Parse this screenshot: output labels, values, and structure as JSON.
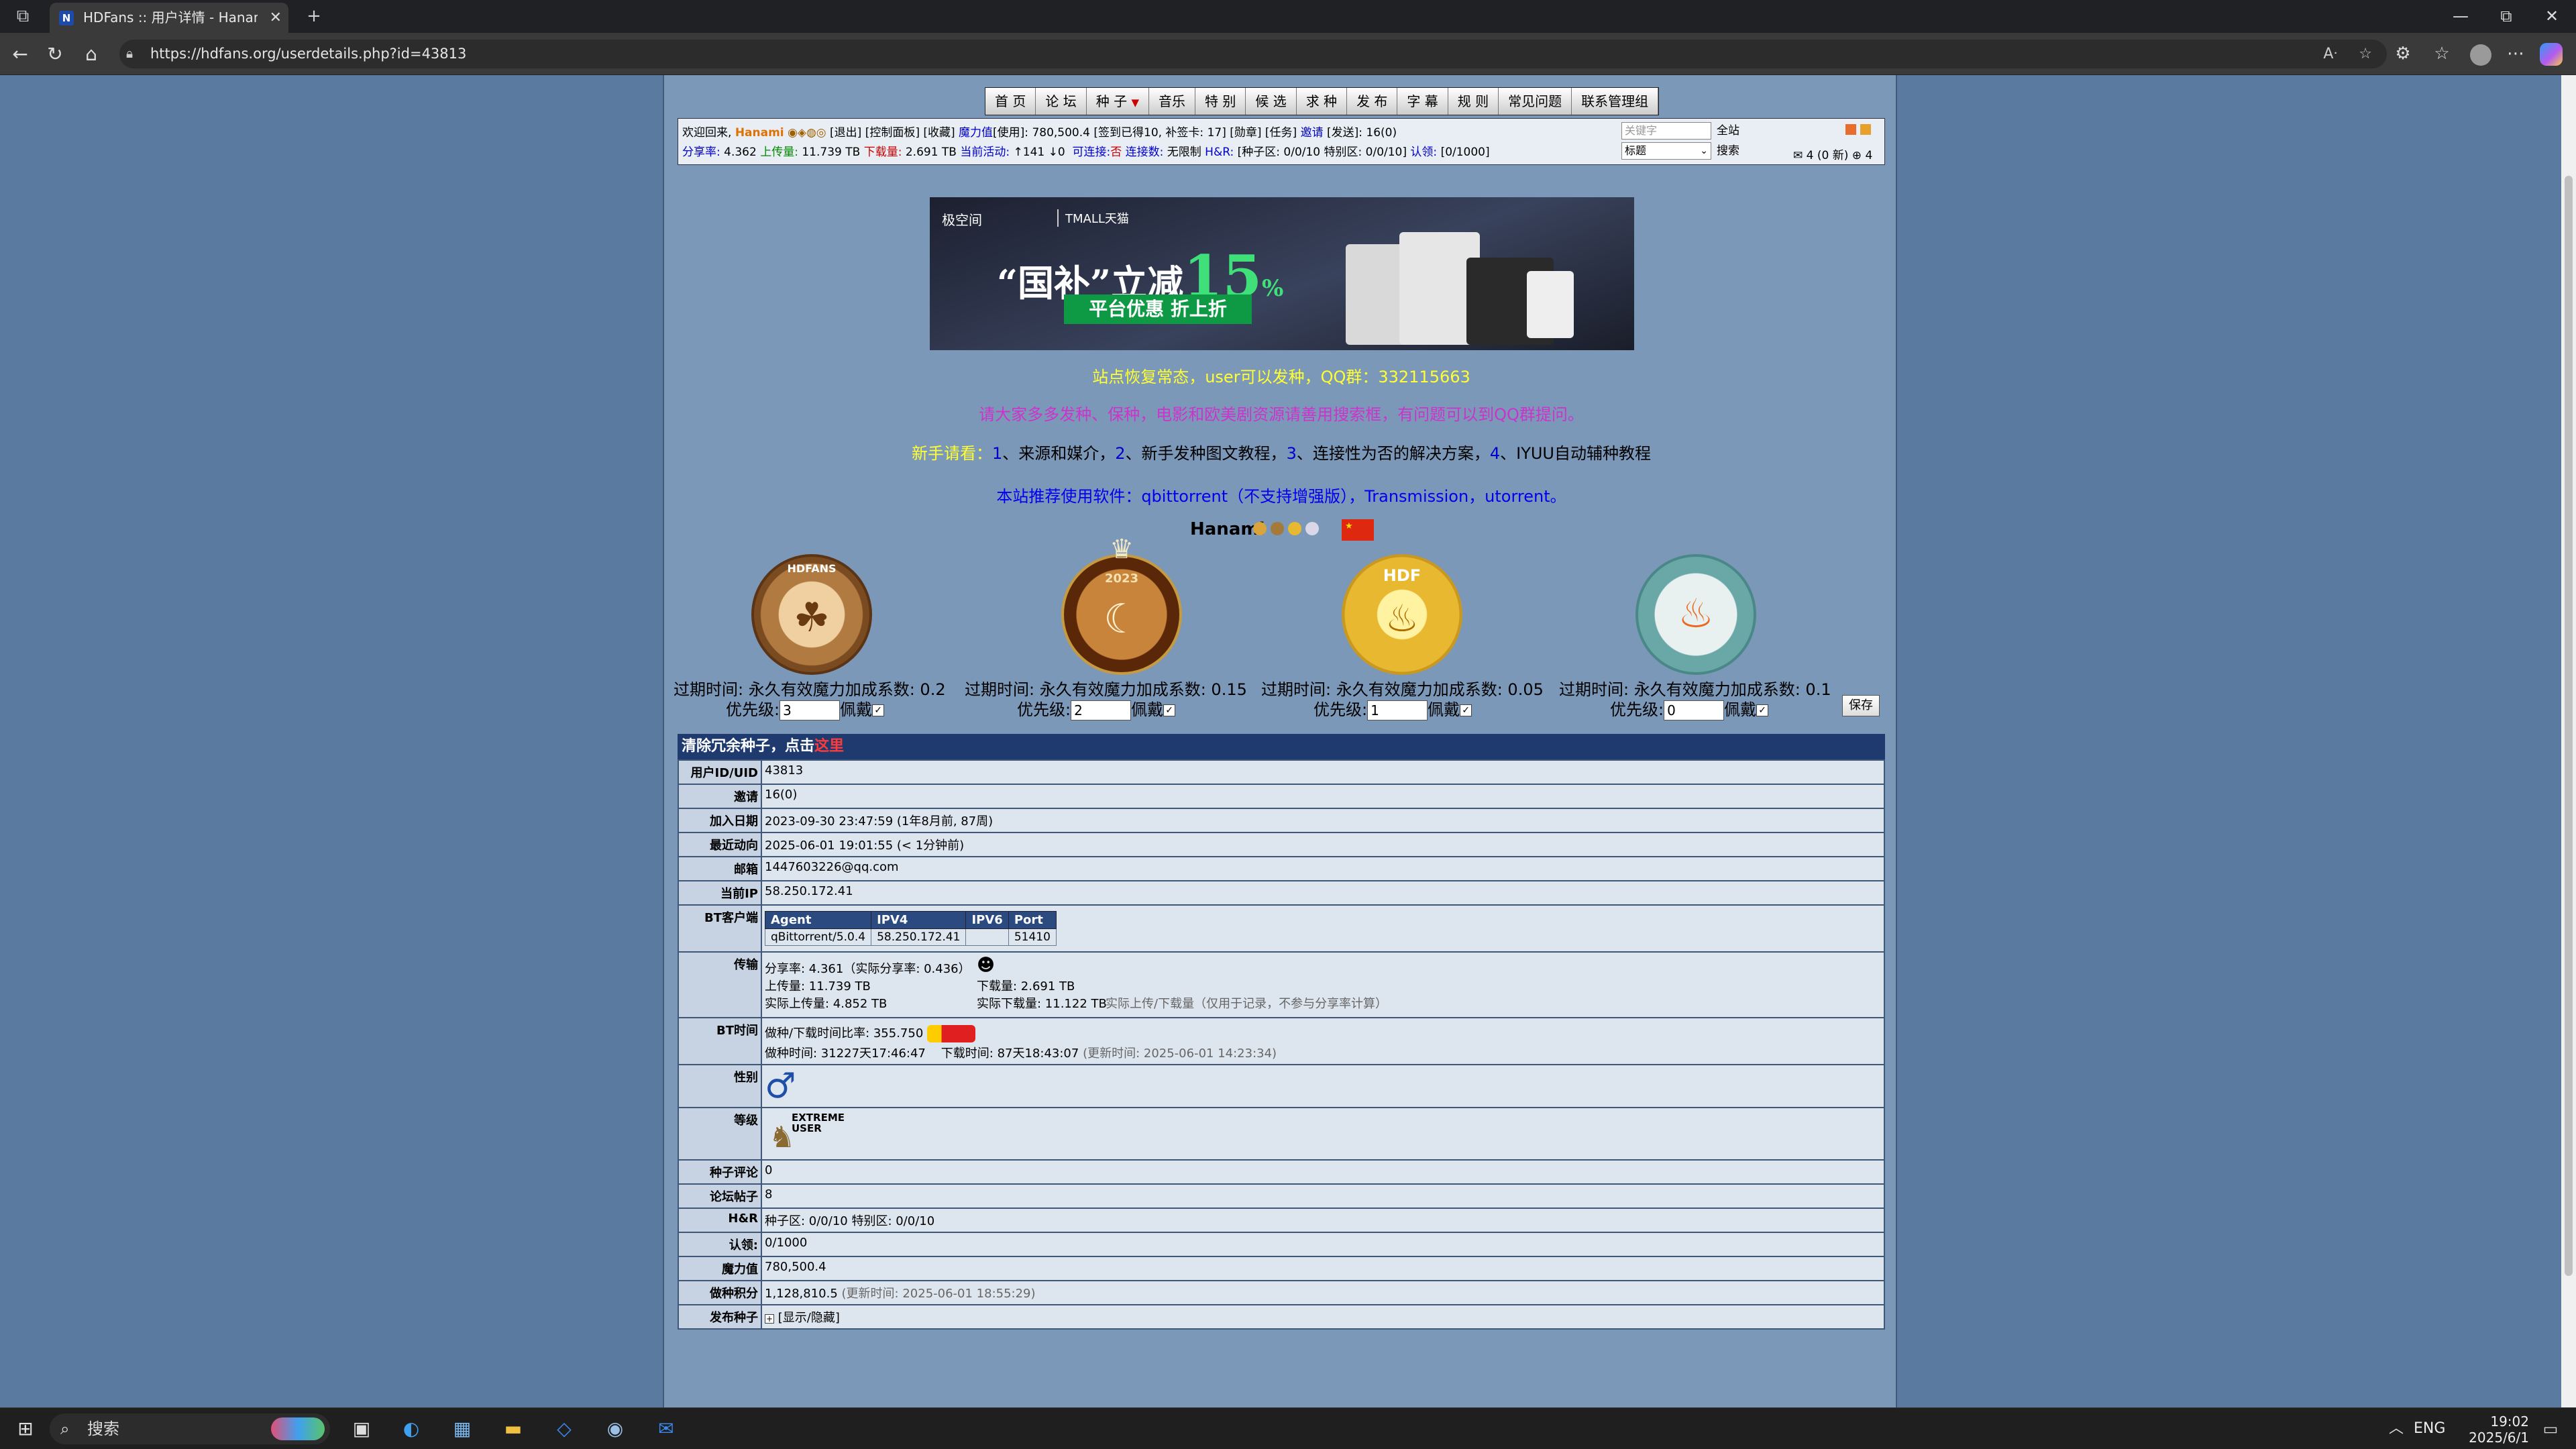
{
  "browser": {
    "tab_title": "HDFans :: 用户详情 - Hanami - Po",
    "tab_favicon": "N",
    "url": "https://hdfans.org/userdetails.php?id=43813",
    "icons": [
      "tab-actions-icon",
      "close-tab-icon",
      "new-tab-icon",
      "minimize-icon",
      "restore-icon",
      "close-window-icon",
      "back-icon",
      "refresh-icon",
      "home-icon",
      "lock-icon",
      "read-aloud-icon",
      "favorite-icon",
      "extensions-icon",
      "collections-icon",
      "profile-icon",
      "more-icon",
      "copilot-icon"
    ]
  },
  "nav": {
    "items": [
      "首 页",
      "论 坛",
      "种 子",
      "音乐",
      "特 别",
      "候 选",
      "求 种",
      "发 布",
      "字 幕",
      "规 则",
      "常见问题",
      "联系管理组"
    ]
  },
  "infobar": {
    "line1_prefix": "欢迎回来,",
    "username": "Hanami",
    "line1_links": "[退出] [控制面板] [收藏]",
    "magic_label": "魔力值",
    "line1_rest": "[使用]: 780,500.4 [签到已得10, 补签卡: 17] [勋章] [任务]",
    "invite_label": "邀请",
    "line1_tail": "[发送]: 16(0)",
    "ratio_label": "分享率:",
    "ratio": "4.362",
    "upload_label": "上传量:",
    "upload": "11.739 TB",
    "download_label": "下载量:",
    "download": "2.691 TB",
    "active_label": "当前活动:",
    "active": "↑141 ↓0",
    "connectable_label": "可连接:",
    "connectable": "否",
    "conn_count_label": "连接数:",
    "conn_count": "无限制",
    "hr_label": "H&R:",
    "hr_value": "[种子区: 0/0/10 特别区: 0/0/10]",
    "auth_label": "认领:",
    "auth_value": "[0/1000]",
    "search_placeholder": "关键字",
    "search_select": "标题",
    "btn_all": "全站",
    "btn_search": "搜索",
    "messages": "4 (0 新)",
    "messages2": "4"
  },
  "banner": {
    "brand": "极空间",
    "tmall": "TMALL天猫",
    "headline": "“国补”立减",
    "percent": "15",
    "percent_sign": "%",
    "cta": "平台优惠 折上折"
  },
  "announcements": {
    "a1": "站点恢复常态，user可以发种，QQ群：332115663",
    "a2": "请大家多多发种、保种，电影和欧美剧资源请善用搜索框，有问题可以到QQ群提问。",
    "a3_prefix": "新手请看：",
    "a3_n1": "1",
    "a3_t1": "、来源和媒介，",
    "a3_n2": "2",
    "a3_t2": "、新手发种图文教程，",
    "a3_n3": "3",
    "a3_t3": "、连接性为否的解决方案，",
    "a3_n4": "4",
    "a3_t4": "、IYUU自动辅种教程",
    "a4": "本站推荐使用软件：qbittorrent（不支持增强版），Transmission，utorrent。"
  },
  "profile_name": "Hanami",
  "medals": [
    {
      "caption": "过期时间: 永久有效魔力加成系数: 0.2",
      "prio_label": "优先级:",
      "prio": "3",
      "wear_label": "佩戴"
    },
    {
      "caption": "过期时间: 永久有效魔力加成系数: 0.15",
      "prio_label": "优先级:",
      "prio": "2",
      "wear_label": "佩戴"
    },
    {
      "caption": "过期时间: 永久有效魔力加成系数: 0.05",
      "prio_label": "优先级:",
      "prio": "1",
      "wear_label": "佩戴"
    },
    {
      "caption": "过期时间: 永久有效魔力加成系数: 0.1",
      "prio_label": "优先级:",
      "prio": "0",
      "wear_label": "佩戴"
    }
  ],
  "medal_texts": {
    "m1": "HDFANS",
    "m2": "2023",
    "m3": "HDF"
  },
  "save_label": "保存",
  "clear_bar": {
    "text": "清除冗余种子，点击",
    "link": "这里"
  },
  "details": {
    "uid_k": "用户ID/UID",
    "uid_v": "43813",
    "invite_k": "邀请",
    "invite_v": "16(0)",
    "join_k": "加入日期",
    "join_v": "2023-09-30 23:47:59 (1年8月前, 87周)",
    "last_k": "最近动向",
    "last_v": "2025-06-01 19:01:55 (< 1分钟前)",
    "email_k": "邮箱",
    "email_v": "1447603226@qq.com",
    "ip_k": "当前IP",
    "ip_v": "58.250.172.41",
    "bt_k": "BT客户端",
    "bt_headers": [
      "Agent",
      "IPV4",
      "IPV6",
      "Port"
    ],
    "bt_row": [
      "qBittorrent/5.0.4",
      "58.250.172.41",
      "",
      "51410"
    ],
    "transfer_k": "传输",
    "t_ratio": "分享率: 4.361（实际分享率: 0.436）",
    "t_up": "上传量: 11.739 TB",
    "t_down": "下载量: 2.691 TB",
    "t_realup": "实际上传量: 4.852 TB",
    "t_realdown": "实际下载量: 11.122 TB",
    "t_note": "实际上传/下载量（仅用于记录，不参与分享率计算）",
    "bttime_k": "BT时间",
    "bt_ratio": "做种/下载时间比率: 355.750",
    "bt_seed": "做种时间: 31227天17:46:47",
    "bt_dl": "下载时间: 87天18:43:07",
    "bt_upd": "(更新时间: 2025-06-01 14:23:34)",
    "sex_k": "性别",
    "sex_v": "♂",
    "level_k": "等级",
    "level_v": "EXTREME USER",
    "comments_k": "种子评论",
    "comments_v": "0",
    "posts_k": "论坛帖子",
    "posts_v": "8",
    "hr_k": "H&R",
    "hr_v": "种子区: 0/0/10 特别区: 0/0/10",
    "auth_k": "认领:",
    "auth_v": "0/1000",
    "magic_k": "魔力值",
    "magic_v": "780,500.4",
    "seedpts_k": "做种积分",
    "seedpts_v": "1,128,810.5",
    "seedpts_upd": "(更新时间: 2025-06-01 18:55:29)",
    "pub_k": "发布种子",
    "pub_v": "[显示/隐藏]"
  },
  "taskbar": {
    "search": "搜索",
    "lang": "ENG",
    "time": "19:02",
    "date": "2025/6/1"
  }
}
